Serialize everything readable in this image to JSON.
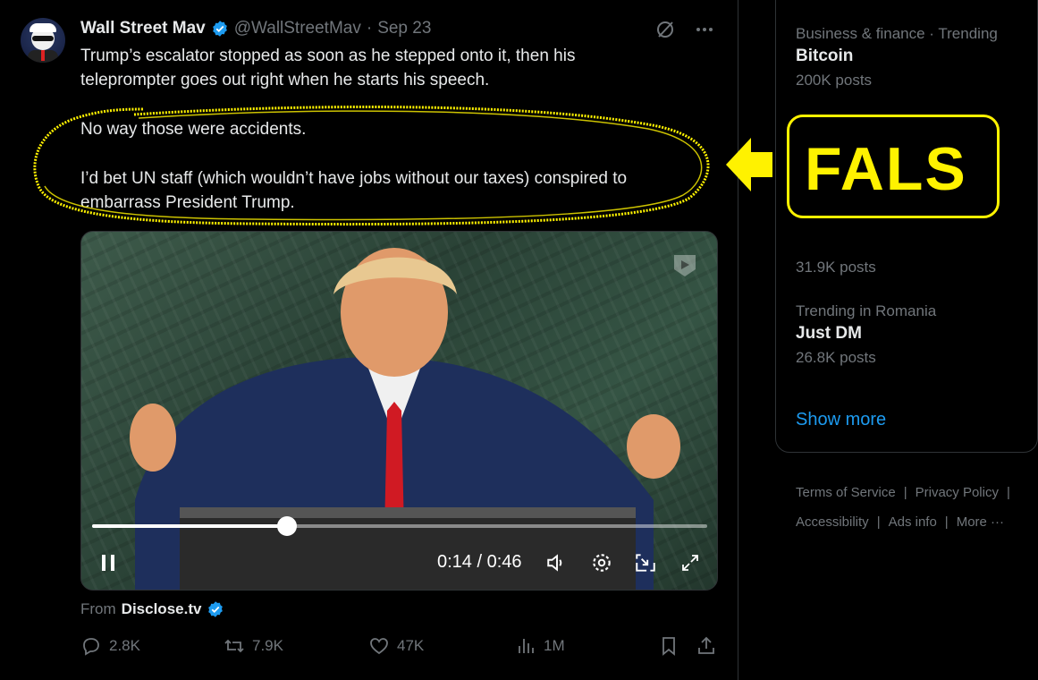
{
  "tweet": {
    "author_name": "Wall Street Mav",
    "handle": "@WallStreetMav",
    "separator": "·",
    "date": "Sep 23",
    "line1": "Trump’s escalator stopped as soon as he stepped onto it, then his",
    "line2": "teleprompter goes out right when he starts his speech.",
    "line3": "No way those were accidents.",
    "line4": "I’d bet UN staff (which wouldn’t have jobs without our taxes) conspired to",
    "line5": "embarrass President Trump.",
    "from_label": "From",
    "from_source": "Disclose.tv"
  },
  "video": {
    "time": "0:14 / 0:46",
    "progress_fraction": 0.317
  },
  "actions": {
    "replies": "2.8K",
    "reposts": "7.9K",
    "likes": "47K",
    "views": "1M"
  },
  "annotation": {
    "overlay_text": "FALS",
    "color": "#fff200"
  },
  "sidebar": {
    "trend1_category": "Business & finance · Trending",
    "trend1_title": "Bitcoin",
    "trend1_posts": "200K posts",
    "trend2_posts": "31.9K posts",
    "trend3_category": "Trending in Romania",
    "trend3_title": "Just DM",
    "trend3_posts": "26.8K posts",
    "show_more": "Show more"
  },
  "footer": {
    "terms": "Terms of Service",
    "privacy": "Privacy Policy",
    "accessibility": "Accessibility",
    "ads_info": "Ads info",
    "more": "More ···",
    "sep": "|"
  },
  "colors": {
    "accent": "#1d9bf0",
    "muted": "#71767b",
    "text": "#e7e9ea",
    "border": "#2f3336",
    "highlight": "#fff200"
  }
}
